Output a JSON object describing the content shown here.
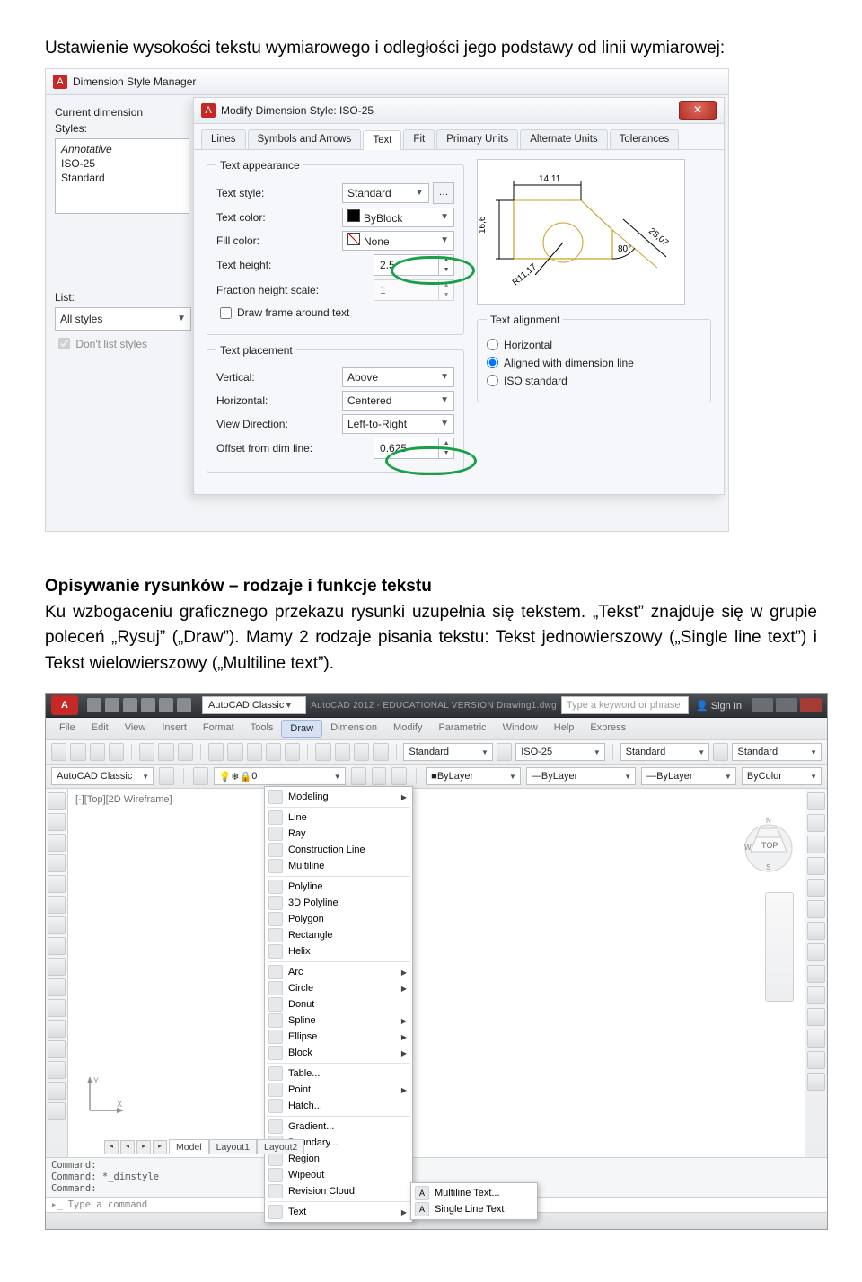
{
  "doc": {
    "title_line": "Ustawienie wysokości tekstu wymiarowego i odległości jego podstawy od linii wymiarowej:",
    "heading2": "Opisywanie rysunków – rodzaje i funkcje tekstu",
    "para2": "Ku wzbogaceniu graficznego przekazu rysunki uzupełnia się tekstem. „Tekst” znajduje się w grupie poleceń „Rysuj” („Draw”). Mamy 2 rodzaje pisania tekstu: Tekst jednowierszowy („Single line text”) i Tekst wielowierszowy („Multiline text”)."
  },
  "dlg1": {
    "app_icon": "A",
    "title": "Dimension Style Manager",
    "left": {
      "current_label": "Current dimension",
      "styles_label": "Styles:",
      "styles": [
        "Annotative",
        "ISO-25",
        "Standard"
      ],
      "list_label": "List:",
      "list_value": "All styles",
      "dont_list": "Don't list styles"
    }
  },
  "dlg2": {
    "app_icon": "A",
    "title": "Modify Dimension Style: ISO-25",
    "tabs": [
      "Lines",
      "Symbols and Arrows",
      "Text",
      "Fit",
      "Primary Units",
      "Alternate Units",
      "Tolerances"
    ],
    "appearance": {
      "legend": "Text appearance",
      "style_label": "Text style:",
      "style_value": "Standard",
      "color_label": "Text color:",
      "color_value": "ByBlock",
      "fill_label": "Fill color:",
      "fill_value": "None",
      "height_label": "Text height:",
      "height_value": "2.5",
      "fraction_label": "Fraction height scale:",
      "fraction_value": "1",
      "frame_chk": "Draw frame around text"
    },
    "placement": {
      "legend": "Text placement",
      "vertical_label": "Vertical:",
      "vertical_value": "Above",
      "horizontal_label": "Horizontal:",
      "horizontal_value": "Centered",
      "viewdir_label": "View Direction:",
      "viewdir_value": "Left-to-Right",
      "offset_label": "Offset from dim line:",
      "offset_value": "0.625"
    },
    "alignment": {
      "legend": "Text alignment",
      "opt1": "Horizontal",
      "opt2": "Aligned with dimension line",
      "opt3": "ISO standard"
    },
    "preview": {
      "d1": "14,11",
      "d2": "16,6",
      "d3": "28,07",
      "d4": "R11,17",
      "ang": "80°"
    }
  },
  "acad": {
    "workspace": "AutoCAD Classic",
    "title_center": "AutoCAD 2012 - EDUCATIONAL VERSION   Drawing1.dwg",
    "search_ph": "Type a keyword or phrase",
    "signin": "Sign In",
    "menus": [
      "File",
      "Edit",
      "View",
      "Insert",
      "Format",
      "Tools",
      "Draw",
      "Dimension",
      "Modify",
      "Parametric",
      "Window",
      "Help",
      "Express"
    ],
    "classic2": "AutoCAD Classic",
    "layer_combo": "0",
    "std1": "Standard",
    "std2": "ISO-25",
    "std3": "Standard",
    "std4": "Standard",
    "prop_bylayer1": "ByLayer",
    "prop_bylayer2": "ByLayer",
    "prop_bylayer3": "ByLayer",
    "prop_bycolor": "ByColor",
    "view_label": "[-][Top][2D Wireframe]",
    "viewcube_top": "TOP",
    "viewcube_w": "W",
    "viewcube_s": "S",
    "model_tabs_model": "Model",
    "model_tabs_layout1": "Layout1",
    "model_tabs_layout2": "Layout2",
    "cmd_line1": "Command:",
    "cmd_line2": "Command: *_dimstyle",
    "cmd_line3": "Command:",
    "cmd_prompt": "Type a command"
  },
  "drawmenu": {
    "items": [
      {
        "label": "Modeling",
        "sub": true
      },
      {
        "sep": true
      },
      {
        "label": "Line"
      },
      {
        "label": "Ray"
      },
      {
        "label": "Construction Line"
      },
      {
        "label": "Multiline"
      },
      {
        "sep": true
      },
      {
        "label": "Polyline"
      },
      {
        "label": "3D Polyline"
      },
      {
        "label": "Polygon"
      },
      {
        "label": "Rectangle"
      },
      {
        "label": "Helix"
      },
      {
        "sep": true
      },
      {
        "label": "Arc",
        "sub": true
      },
      {
        "label": "Circle",
        "sub": true
      },
      {
        "label": "Donut"
      },
      {
        "label": "Spline",
        "sub": true
      },
      {
        "label": "Ellipse",
        "sub": true
      },
      {
        "label": "Block",
        "sub": true
      },
      {
        "sep": true
      },
      {
        "label": "Table..."
      },
      {
        "label": "Point",
        "sub": true
      },
      {
        "label": "Hatch..."
      },
      {
        "sep": true
      },
      {
        "label": "Gradient..."
      },
      {
        "label": "Boundary..."
      },
      {
        "label": "Region"
      },
      {
        "label": "Wipeout"
      },
      {
        "label": "Revision Cloud"
      },
      {
        "sep": true
      },
      {
        "label": "Text",
        "sub": true
      }
    ],
    "text_sub": [
      "Multiline Text...",
      "Single Line Text"
    ]
  }
}
